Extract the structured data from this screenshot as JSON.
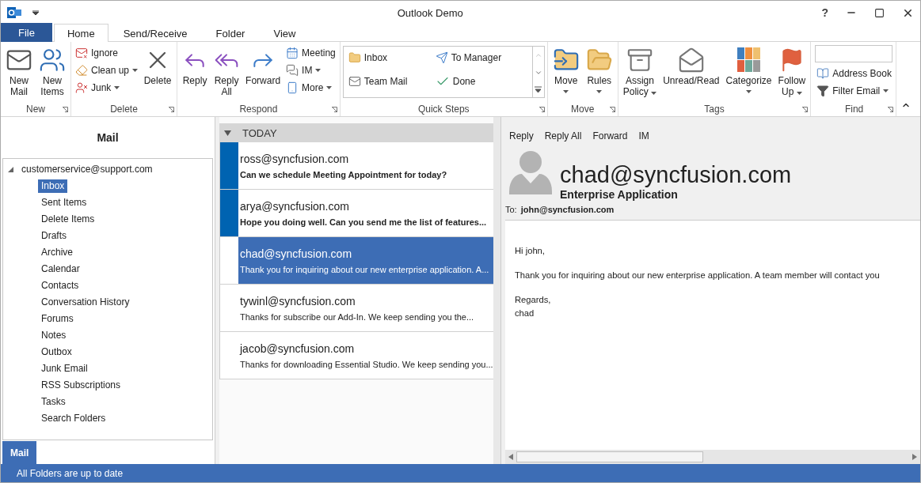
{
  "window": {
    "title": "Outlook Demo",
    "help": "?"
  },
  "ribbon_tabs": [
    {
      "label": "File",
      "kind": "file",
      "selected": false
    },
    {
      "label": "Home",
      "kind": "tab",
      "selected": true
    },
    {
      "label": "Send/Receive",
      "kind": "tab",
      "selected": false
    },
    {
      "label": "Folder",
      "kind": "tab",
      "selected": false
    },
    {
      "label": "View",
      "kind": "tab",
      "selected": false
    }
  ],
  "ribbon": {
    "groups": [
      {
        "label": "New",
        "items": [
          {
            "kind": "large",
            "label": "New\nMail",
            "dropdown": false
          },
          {
            "kind": "large",
            "label": "New\nItems",
            "dropdown": false
          }
        ]
      },
      {
        "label": "Delete",
        "items": [
          {
            "kind": "stack",
            "items": [
              {
                "label": "Ignore",
                "dropdown": false
              },
              {
                "label": "Clean up",
                "dropdown": true
              },
              {
                "label": "Junk",
                "dropdown": true
              }
            ]
          },
          {
            "kind": "large",
            "label": "Delete",
            "dropdown": false
          }
        ]
      },
      {
        "label": "Respond",
        "items": [
          {
            "kind": "large",
            "label": "Reply",
            "dropdown": false
          },
          {
            "kind": "large",
            "label": "Reply\nAll",
            "dropdown": false
          },
          {
            "kind": "large",
            "label": "Forward",
            "dropdown": false
          },
          {
            "kind": "stack",
            "items": [
              {
                "label": "Meeting",
                "dropdown": false
              },
              {
                "label": "IM",
                "dropdown": true
              },
              {
                "label": "More",
                "dropdown": true
              }
            ]
          }
        ]
      },
      {
        "label": "Quick Steps",
        "items": [
          {
            "kind": "gallery",
            "items": [
              {
                "label": "Inbox",
                "dropdown": false
              },
              {
                "label": "To Manager",
                "dropdown": false
              },
              {
                "label": "Team Mail",
                "dropdown": false
              },
              {
                "label": "Done",
                "dropdown": false
              }
            ]
          }
        ]
      },
      {
        "label": "Move",
        "items": [
          {
            "kind": "large",
            "label": "Move",
            "dropdown": true
          },
          {
            "kind": "large",
            "label": "Rules",
            "dropdown": true
          }
        ]
      },
      {
        "label": "Tags",
        "items": [
          {
            "kind": "large",
            "label": "Assign\nPolicy",
            "dropdown": true
          },
          {
            "kind": "large",
            "label": "Unread/Read",
            "dropdown": false
          },
          {
            "kind": "large",
            "label": "Categorize",
            "dropdown": true
          },
          {
            "kind": "large",
            "label": "Follow\nUp",
            "dropdown": true
          }
        ]
      },
      {
        "label": "Find",
        "items": [
          {
            "kind": "search"
          },
          {
            "kind": "stack",
            "items": [
              {
                "label": "Address Book",
                "dropdown": false
              },
              {
                "label": "Filter Email",
                "dropdown": true
              }
            ]
          }
        ]
      }
    ]
  },
  "navigation": {
    "title": "Mail",
    "tree": [
      {
        "label": "customerservice@support.com",
        "expanded": true,
        "selected": false,
        "children": [
          {
            "label": "Inbox",
            "selected": true
          },
          {
            "label": "Sent Items",
            "selected": false
          },
          {
            "label": "Delete Items",
            "selected": false
          },
          {
            "label": "Drafts",
            "selected": false
          },
          {
            "label": "Archive",
            "selected": false
          },
          {
            "label": "Calendar",
            "selected": false
          },
          {
            "label": "Contacts",
            "selected": false
          },
          {
            "label": "Conversation History",
            "selected": false
          },
          {
            "label": "Forums",
            "selected": false
          },
          {
            "label": "Notes",
            "selected": false
          },
          {
            "label": "Outbox",
            "selected": false
          },
          {
            "label": "Junk Email",
            "selected": false
          },
          {
            "label": "RSS Subscriptions",
            "selected": false
          },
          {
            "label": "Tasks",
            "selected": false
          },
          {
            "label": "Search Folders",
            "selected": false
          }
        ]
      }
    ]
  },
  "nav_tabs": [
    {
      "label": "Mail",
      "selected": true
    }
  ],
  "message_list": {
    "group": {
      "label": "TODAY",
      "expanded": true
    },
    "messages": [
      {
        "sender": "ross@syncfusion.com",
        "preview": "Can we schedule Meeting Appointment for today?",
        "unread": true,
        "selected": false
      },
      {
        "sender": "arya@syncfusion.com",
        "preview": "Hope you doing well. Can you send me the list of features...",
        "unread": true,
        "selected": false
      },
      {
        "sender": "chad@syncfusion.com",
        "preview": "Thank you for inquiring about our new enterprise application. A...",
        "unread": false,
        "selected": true
      },
      {
        "sender": "tywinl@syncfusion.com",
        "preview": "Thanks for subscribe our Add-In. We keep sending you the...",
        "unread": false,
        "selected": false
      },
      {
        "sender": "jacob@syncfusion.com",
        "preview": "Thanks for downloading Essential Studio. We keep sending you...",
        "unread": false,
        "selected": false
      }
    ]
  },
  "reading_pane": {
    "actions": [
      "Reply",
      "Reply All",
      "Forward",
      "IM"
    ],
    "sender": "chad@syncfusion.com",
    "subject": "Enterprise Application",
    "to_label": "To:",
    "to": "john@syncfusion.com",
    "body": [
      "Hi john,",
      "Thank you for inquiring about our new enterprise application. A team member will contact you",
      "Regards,\nchad"
    ]
  },
  "status_bar": {
    "text": "All Folders are up to date"
  }
}
